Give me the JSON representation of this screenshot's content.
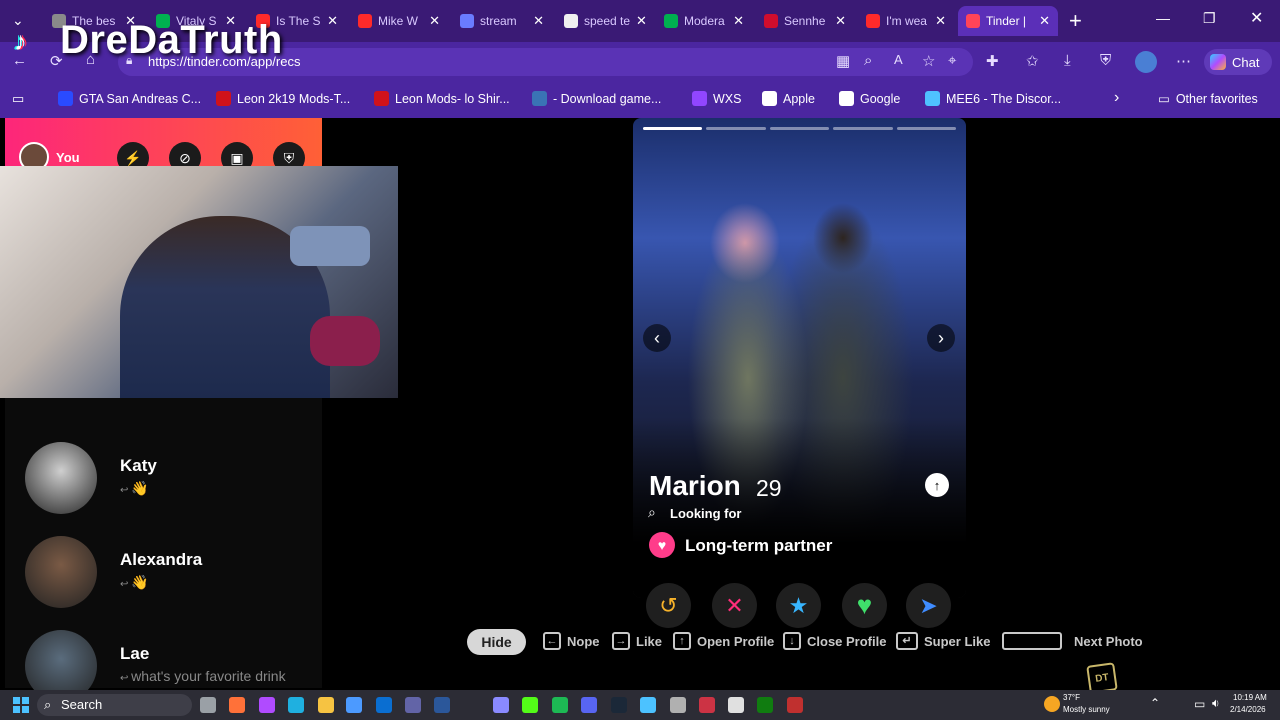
{
  "browser": {
    "tabs": [
      {
        "label": "The bes",
        "color": "#8a8a8a"
      },
      {
        "label": "Vitaly S",
        "color": "#00b050"
      },
      {
        "label": "Is The S",
        "color": "#ff2a2a"
      },
      {
        "label": "Mike W",
        "color": "#ff2a2a"
      },
      {
        "label": "stream",
        "color": "#6a7cff"
      },
      {
        "label": "speed te",
        "color": "#f0f0f0"
      },
      {
        "label": "Modera",
        "color": "#00b050"
      },
      {
        "label": "Sennhe",
        "color": "#d00d2d"
      },
      {
        "label": "I'm wea",
        "color": "#ff2a2a"
      },
      {
        "label": "Tinder |",
        "color": "#ff4458"
      }
    ],
    "close_glyph": "✕",
    "new_tab_glyph": "+",
    "address": "https://tinder.com/app/recs",
    "chat_label": "Chat",
    "bookmarks": [
      {
        "label": "GTA San Andreas C...",
        "color": "#2a4bff"
      },
      {
        "label": "Leon 2k19 Mods-T...",
        "color": "#d0121b"
      },
      {
        "label": "Leon Mods- lo Shir...",
        "color": "#d0121b"
      },
      {
        "label": "- Download game...",
        "color": "#3a73b5"
      },
      {
        "label": "WXS",
        "color": "#9146ff"
      },
      {
        "label": "Apple",
        "color": "#ffffff"
      },
      {
        "label": "Google",
        "color": "#ffffff"
      },
      {
        "label": "MEE6 - The Discor...",
        "color": "#4fc1ff"
      }
    ],
    "other_favorites": "Other favorites"
  },
  "overlay": {
    "channel_logo": "DreDaTruth"
  },
  "left_panel": {
    "you_label": "You",
    "matches": [
      {
        "name": "Katy",
        "preview": "👋"
      },
      {
        "name": "Alexandra",
        "preview": "👋"
      },
      {
        "name": "Lae",
        "preview": "what's your favorite drink"
      }
    ]
  },
  "card": {
    "name": "Marion",
    "age": "29",
    "looking_for_label": "Looking for",
    "preference": "Long-term partner",
    "photo_index": 1,
    "photo_count": 5
  },
  "actions": [
    {
      "name": "rewind",
      "glyph": "↺",
      "color": "#f6b22a"
    },
    {
      "name": "nope",
      "glyph": "✕",
      "color": "#ff2d7a"
    },
    {
      "name": "super-like",
      "glyph": "★",
      "color": "#38b6ff"
    },
    {
      "name": "like",
      "glyph": "♥",
      "color": "#3fe06b"
    },
    {
      "name": "boost",
      "glyph": "➤",
      "color": "#3f8cff"
    }
  ],
  "hints": {
    "hide": "Hide",
    "nope": "Nope",
    "like": "Like",
    "open_profile": "Open Profile",
    "close_profile": "Close Profile",
    "super_like": "Super Like",
    "next_photo": "Next Photo"
  },
  "taskbar": {
    "search": "Search",
    "weather_temp": "37°F",
    "weather_desc": "Mostly sunny",
    "time": "10:19 AM",
    "date": "2/14/2026"
  }
}
